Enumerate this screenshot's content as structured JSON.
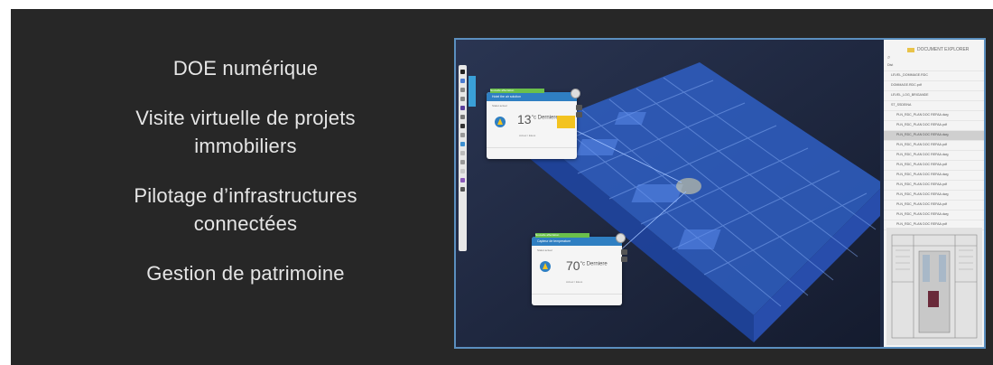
{
  "features": [
    "DOE numérique",
    "Visite virtuelle de projets immobiliers",
    "Pilotage d’infrastructures connectées",
    "Gestion de patrimoine"
  ],
  "explorer": {
    "title": "DOCUMENT EXPLORER",
    "items": [
      "Dist",
      "LEVEL_DOMMAGE.RDC",
      "DOMMAGE.RDC.pdf",
      "LEVEL_LOG_BRIGANDE",
      "ST_SSDEINA",
      "PLN_RDC_PLAN DOC REFAA.dwg",
      "PLN_RDC_PLAN DOC REFAA.pdf",
      "PLN_RDC_PLAN DOC REFAA.dwg",
      "PLN_RDC_PLAN DOC REFAA.pdf",
      "PLN_RDC_PLAN DOC REFAA.dwg",
      "PLN_RDC_PLAN DOC REFAA.pdf",
      "PLN_RDC_PLAN DOC REFAA.dwg",
      "PLN_RDC_PLAN DOC REFAA.pdf",
      "PLN_RDC_PLAN DOC REFAA.dwg",
      "PLN_RDC_PLAN DOC REFAA.pdf",
      "PLN_RDC_PLAN DOC REFAA.dwg",
      "PLN_RDC_PLAN DOC REFAA.pdf"
    ],
    "selected_index": 7
  },
  "cards": [
    {
      "tag": "Nouvelle affectation",
      "header": "Hotel the air solution",
      "sub": "Statut actuel",
      "temp": "13",
      "unit": "°c Derniere",
      "status": "Actuel / Elevé"
    },
    {
      "tag": "Nouvelle affectation",
      "header": "Capteur de temperature",
      "sub": "Statut actuel",
      "temp": "70",
      "unit": "°c Derniere",
      "status": "Actuel / Elevé"
    }
  ],
  "colors": {
    "accent": "#2f7fc2",
    "building": "#3a6fd8",
    "background": "#272727"
  }
}
